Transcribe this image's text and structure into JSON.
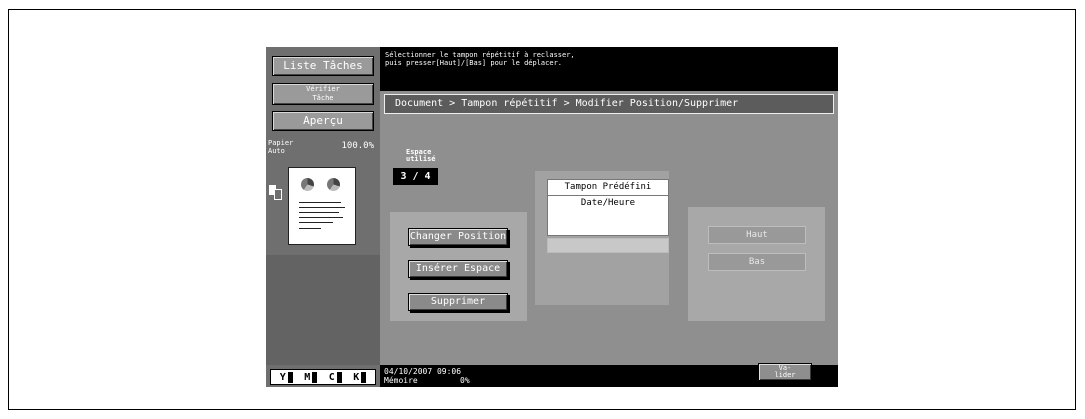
{
  "left_panel": {
    "job_list": "Liste Tâches",
    "verify_line1": "Vérifier",
    "verify_line2": "Tâche",
    "preview": "Aperçu",
    "paper_line1": "Papier",
    "paper_line2": "Auto",
    "zoom": "100.0%",
    "page_icon_label": "1 2",
    "toner": [
      "Y",
      "M",
      "C",
      "K"
    ]
  },
  "message": {
    "line1": "Sélectionner le tampon répétitif à reclasser,",
    "line2": "puis presser[Haut]/[Bas] pour le déplacer."
  },
  "breadcrumb": "Document  >  Tampon répétitif > Modifier Position/Supprimer",
  "space": {
    "label_line1": "Espace",
    "label_line2": "utilisé",
    "value": "3 / 4"
  },
  "actions": {
    "change_position": "Changer Position",
    "insert_space": "Insérer Espace",
    "delete": "Supprimer"
  },
  "stamp_list": {
    "header": "Tampon Prédéfini",
    "item": "Date/Heure"
  },
  "move": {
    "up": "Haut",
    "down": "Bas"
  },
  "status": {
    "datetime": "04/10/2007   09:06",
    "memory_label": "Mémoire",
    "memory_value": "0%"
  },
  "validate": {
    "line1": "Va-",
    "line2": "lider"
  }
}
